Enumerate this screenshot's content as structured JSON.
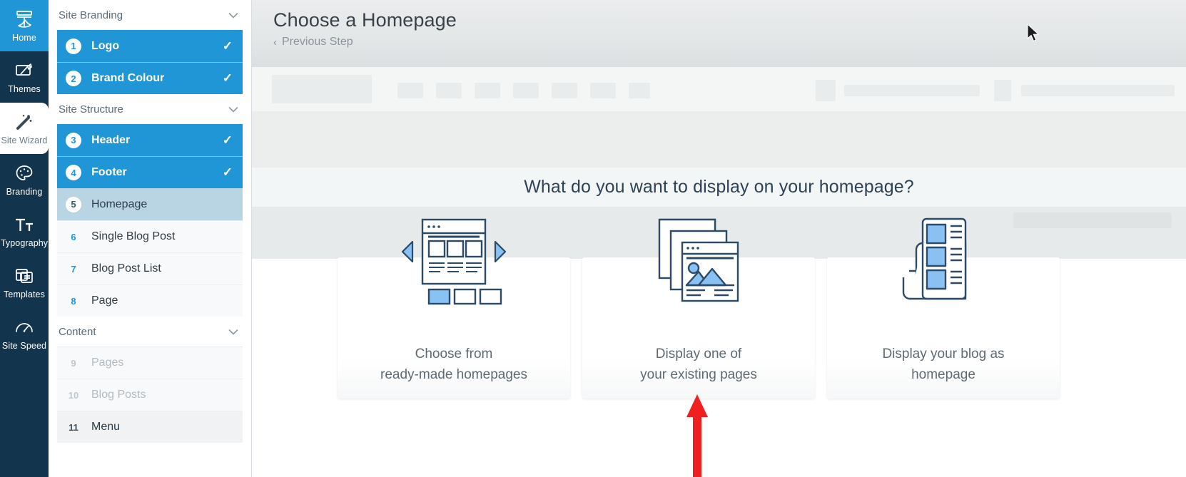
{
  "rail": {
    "items": [
      {
        "label": "Home",
        "icon": "home-dashboard-icon",
        "state": "active-blue"
      },
      {
        "label": "Themes",
        "icon": "themes-brush-icon",
        "state": "normal"
      },
      {
        "label": "Site Wizard",
        "icon": "magic-wand-icon",
        "state": "active-white"
      },
      {
        "label": "Branding",
        "icon": "palette-icon",
        "state": "normal"
      },
      {
        "label": "Typography",
        "icon": "typography-tt-icon",
        "state": "normal"
      },
      {
        "label": "Templates",
        "icon": "templates-icon",
        "state": "normal"
      },
      {
        "label": "Site Speed",
        "icon": "speedometer-icon",
        "state": "normal"
      }
    ]
  },
  "sidebar": {
    "groups": [
      {
        "title": "Site Branding",
        "steps": [
          {
            "num": "1",
            "label": "Logo",
            "state": "done",
            "tick": "✓"
          },
          {
            "num": "2",
            "label": "Brand Colour",
            "state": "done",
            "tick": "✓"
          }
        ]
      },
      {
        "title": "Site Structure",
        "steps": [
          {
            "num": "3",
            "label": "Header",
            "state": "done",
            "tick": "✓"
          },
          {
            "num": "4",
            "label": "Footer",
            "state": "done",
            "tick": "✓"
          },
          {
            "num": "5",
            "label": "Homepage",
            "state": "current",
            "tick": ""
          },
          {
            "num": "6",
            "label": "Single Blog Post",
            "state": "idle",
            "tick": ""
          },
          {
            "num": "7",
            "label": "Blog Post List",
            "state": "idle",
            "tick": ""
          },
          {
            "num": "8",
            "label": "Page",
            "state": "idle",
            "tick": ""
          }
        ]
      },
      {
        "title": "Content",
        "steps": [
          {
            "num": "9",
            "label": "Pages",
            "state": "disabled",
            "tick": ""
          },
          {
            "num": "10",
            "label": "Blog Posts",
            "state": "disabled",
            "tick": ""
          },
          {
            "num": "11",
            "label": "Menu",
            "state": "plain",
            "tick": ""
          }
        ]
      }
    ]
  },
  "header": {
    "title": "Choose a Homepage",
    "previous_step": "Previous Step",
    "back_chevron": "‹"
  },
  "content": {
    "question": "What do you want to display on your homepage?",
    "cards": [
      {
        "caption_line1": "Choose from",
        "caption_line2": "ready-made homepages",
        "icon": "carousel-layout-icon"
      },
      {
        "caption_line1": "Display one of",
        "caption_line2": "your existing pages",
        "icon": "stacked-pages-icon"
      },
      {
        "caption_line1": "Display your blog as",
        "caption_line2": "homepage",
        "icon": "newspaper-blog-icon"
      }
    ]
  },
  "annotation": {
    "arrow_color": "#ef2020",
    "points_to": "Display one of your existing pages"
  },
  "colors": {
    "rail_bg": "#12344d",
    "accent_blue": "#2196d6",
    "current_step": "#b9d4e3",
    "icon_stroke": "#2d4a66",
    "icon_fill": "#89c1f2"
  }
}
